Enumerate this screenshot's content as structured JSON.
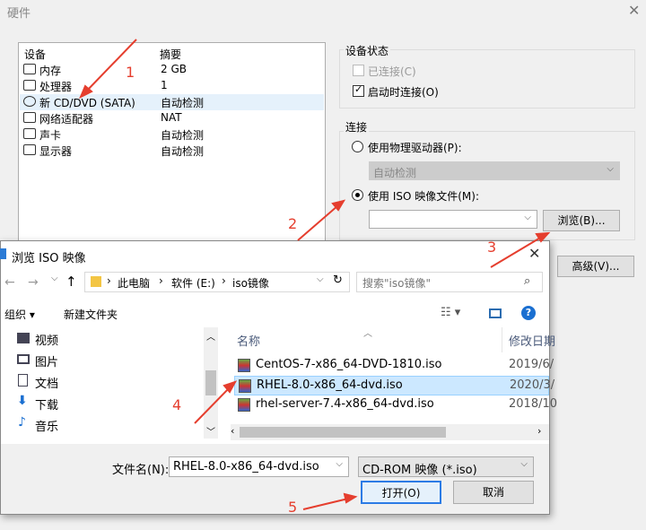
{
  "window": {
    "title": "硬件",
    "close": "✕"
  },
  "device_table": {
    "header_device": "设备",
    "header_summary": "摘要",
    "rows": [
      {
        "name": "内存",
        "summary": "2 GB"
      },
      {
        "name": "处理器",
        "summary": "1"
      },
      {
        "name": "新 CD/DVD (SATA)",
        "summary": "自动检测"
      },
      {
        "name": "网络适配器",
        "summary": "NAT"
      },
      {
        "name": "声卡",
        "summary": "自动检测"
      },
      {
        "name": "显示器",
        "summary": "自动检测"
      }
    ]
  },
  "device_status": {
    "label": "设备状态",
    "connected": "已连接(C)",
    "connect_at_power_on": "启动时连接(O)"
  },
  "connection": {
    "label": "连接",
    "physical": "使用物理驱动器(P):",
    "physical_value": "自动检测",
    "iso": "使用 ISO 映像文件(M):",
    "iso_value": "",
    "browse": "浏览(B)...",
    "advanced": "高级(V)..."
  },
  "dialog": {
    "title": "浏览 ISO 映像",
    "close": "✕",
    "path": [
      "此电脑",
      "软件 (E:)",
      "iso镜像"
    ],
    "search_placeholder": "搜索\"iso镜像\"",
    "organize": "组织 ▾",
    "new_folder": "新建文件夹",
    "nav": [
      "视频",
      "图片",
      "文档",
      "下载",
      "音乐"
    ],
    "col_name": "名称",
    "col_date": "修改日期",
    "files": [
      {
        "name": "CentOS-7-x86_64-DVD-1810.iso",
        "date": "2019/6/"
      },
      {
        "name": "RHEL-8.0-x86_64-dvd.iso",
        "date": "2020/3/"
      },
      {
        "name": "rhel-server-7.4-x86_64-dvd.iso",
        "date": "2018/10"
      }
    ],
    "filename_label": "文件名(N):",
    "filename_value": "RHEL-8.0-x86_64-dvd.iso",
    "filetype": "CD-ROM 映像 (*.iso)",
    "open": "打开(O)",
    "cancel": "取消"
  },
  "annotations": [
    "1",
    "2",
    "3",
    "4",
    "5"
  ],
  "colors": {
    "annotation": "#e53e2e",
    "selection": "#cce8ff"
  }
}
